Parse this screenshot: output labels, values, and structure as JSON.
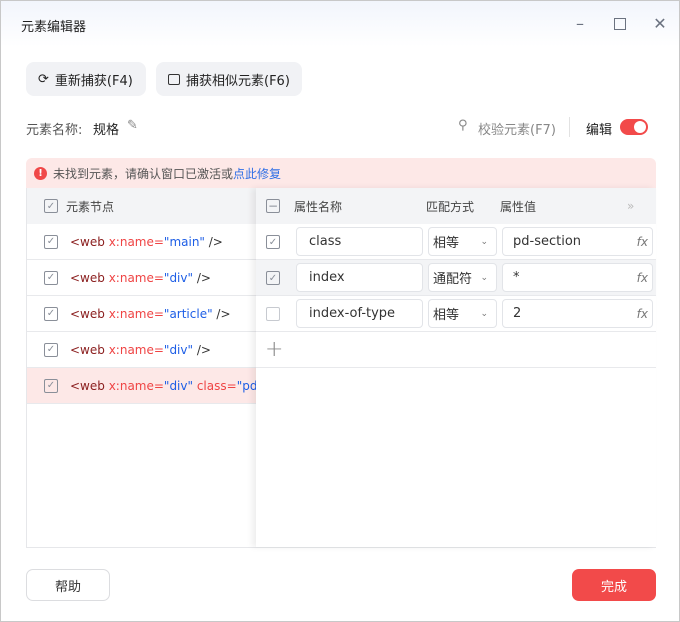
{
  "window": {
    "title": "元素编辑器"
  },
  "toolbar": {
    "recapture": "重新捕获(F4)",
    "capture_similar": "捕获相似元素(F6)"
  },
  "element": {
    "name_label": "元素名称:",
    "name_value": "规格",
    "validate": "校验元素(F7)",
    "edit_label": "编辑",
    "edit_on": true
  },
  "alert": {
    "message": "未找到元素，请确认窗口已激活或",
    "link": "点此修复"
  },
  "nodes": {
    "header": "元素节点",
    "items": [
      {
        "tag": "<web",
        "attr": " x:name=",
        "val": "\"main\"",
        "end": " />"
      },
      {
        "tag": "<web",
        "attr": " x:name=",
        "val": "\"div\"",
        "end": " />"
      },
      {
        "tag": "<web",
        "attr": " x:name=",
        "val": "\"article\"",
        "end": " />"
      },
      {
        "tag": "<web",
        "attr": " x:name=",
        "val": "\"div\"",
        "end": " />"
      },
      {
        "tag": "<web",
        "attr": " x:name=",
        "val": "\"div\"",
        "attr2": " class=",
        "val2": "\"pd-section\""
      }
    ]
  },
  "attrs": {
    "col_name": "属性名称",
    "col_match": "匹配方式",
    "col_value": "属性值",
    "rows": [
      {
        "name": "class",
        "match": "相等",
        "value": "pd-section",
        "checked": true
      },
      {
        "name": "index",
        "match": "通配符",
        "value": "*",
        "checked": true
      },
      {
        "name": "index-of-type",
        "match": "相等",
        "value": "2",
        "checked": false
      }
    ]
  },
  "footer": {
    "help": "帮助",
    "done": "完成"
  },
  "colors": {
    "accent": "#f24a4a",
    "link": "#2f6fe6"
  }
}
